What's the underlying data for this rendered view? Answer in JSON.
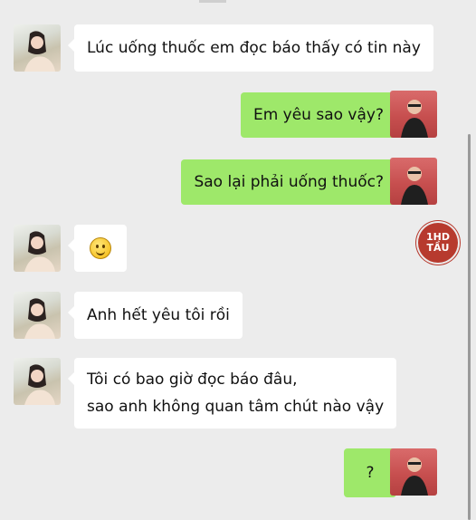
{
  "messages": [
    {
      "side": "left",
      "text": "Lúc uống thuốc em đọc báo thấy có tin này"
    },
    {
      "side": "right",
      "text": "Em yêu sao vậy?"
    },
    {
      "side": "right",
      "text": "Sao lại phải uống thuốc?"
    },
    {
      "side": "left",
      "icon": "smiling-face-emoji-icon"
    },
    {
      "side": "left",
      "text": "Anh hết yêu tôi rồi"
    },
    {
      "side": "left",
      "text_lines": [
        "Tôi có bao giờ đọc báo đâu,",
        "sao anh không quan tâm chút nào vậy"
      ]
    },
    {
      "side": "right",
      "text": "?"
    }
  ],
  "watermark": {
    "line1": "1HD",
    "line2": "TẦU",
    "color": "#b73a2e"
  },
  "colors": {
    "background": "#ececec",
    "incoming_bubble": "#ffffff",
    "outgoing_bubble": "#9ee86a"
  }
}
